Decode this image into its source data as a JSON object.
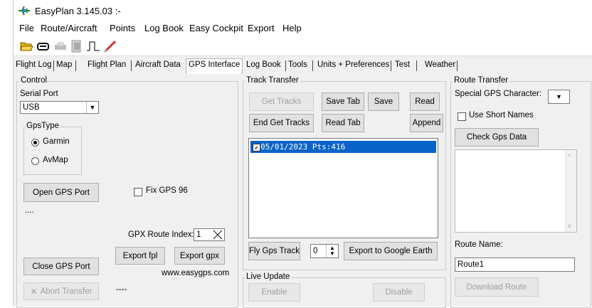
{
  "window": {
    "title": "EasyPlan 3.145.03 :-"
  },
  "menu": [
    "File",
    "Route/Aircraft",
    "Points",
    "Log Book",
    "Easy Cockpit",
    "Export",
    "Help"
  ],
  "toolbar": {
    "icons": [
      "open-folder-icon",
      "aircraft-icon",
      "printer-icon",
      "document-icon",
      "pulse-icon",
      "pen-icon"
    ]
  },
  "tabs": [
    "Flight Log",
    "Map",
    "Flight Plan",
    "Aircraft Data",
    "GPS Interface",
    "Log Book",
    "Tools",
    "Units + Preferences",
    "Test",
    "Weather"
  ],
  "active_tab": "GPS Interface",
  "control": {
    "title": "Control",
    "serial_port_label": "Serial Port",
    "serial_port_value": "USB",
    "gps_type_label": "GpsType",
    "radio_garmin": "Garmin",
    "radio_avmap": "AvMap",
    "open_port": "Open GPS Port",
    "fix_gps": "Fix GPS 96",
    "status_text": "....",
    "gpx_route_index_label": "GPX Route Index:",
    "gpx_route_index_value": "1",
    "export_fpl": "Export fpl",
    "export_gpx": "Export gpx",
    "website": "www.easygps.com",
    "close_port": "Close GPS Port",
    "abort_transfer": "Abort Transfer",
    "abort_status": "----"
  },
  "track_transfer": {
    "title": "Track Transfer",
    "get_tracks": "Get Tracks",
    "save_tab": "Save Tab",
    "save": "Save",
    "read": "Read",
    "end_get_tracks": "End Get Tracks",
    "read_tab": "Read Tab",
    "append": "Append",
    "list_items": [
      "05/01/2023 Pts:416"
    ],
    "fly_gps_track": "Fly Gps Track",
    "fly_value": "0",
    "export_google_earth": "Export to Google Earth"
  },
  "live_update": {
    "title": "Live Update",
    "enable": "Enable",
    "disable": "Disable"
  },
  "route_transfer": {
    "title": "Route Transfer",
    "special_char_label": "Special GPS Character:",
    "use_short_names": "Use Short Names",
    "check_gps_data": "Check Gps Data",
    "route_name_label": "Route Name:",
    "route_name_value": "Route1",
    "download_route": "Download Route"
  },
  "colors": {
    "selection": "#0a64c8",
    "window_bg": "#f0f0f0"
  }
}
